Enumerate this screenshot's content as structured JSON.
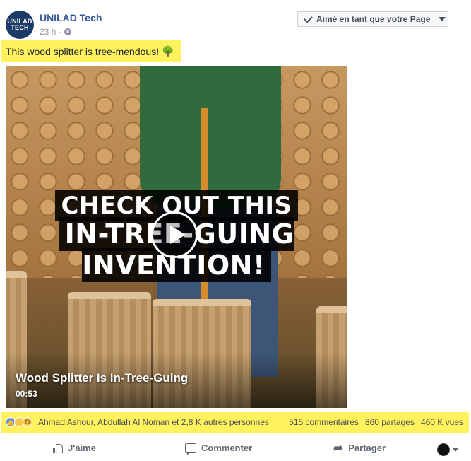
{
  "post": {
    "page_name": "UNILAD Tech",
    "avatar_text_line1": "UNILAD",
    "avatar_text_line2": "TECH",
    "timestamp": "23 h",
    "separator": "·",
    "liked_button_label": "Aimé en tant que votre Page",
    "caption_text": "This wood splitter is tree-mendous!",
    "caption_emoji_icon": "deciduous-tree-icon"
  },
  "video": {
    "overlay_line1": "CHECK OUT THIS",
    "overlay_line2": "IN-TREE-GUING INVENTION!",
    "title": "Wood Splitter Is In-Tree-Guing",
    "duration": "00:53"
  },
  "reactions": {
    "icons": [
      "like-reaction-icon",
      "wow-reaction-icon",
      "haha-reaction-icon"
    ],
    "names_text": "Ahmad Ashour, Abdullah Al Noman et 2,8 K autres personnes",
    "comments": "515 commentaires",
    "shares": "860 partages",
    "views": "460 K vues"
  },
  "actions": {
    "like_label": "J'aime",
    "comment_label": "Commenter",
    "share_label": "Partager"
  },
  "colors": {
    "highlight": "#fff25c",
    "link_blue": "#365899",
    "muted_text": "#90949c"
  }
}
